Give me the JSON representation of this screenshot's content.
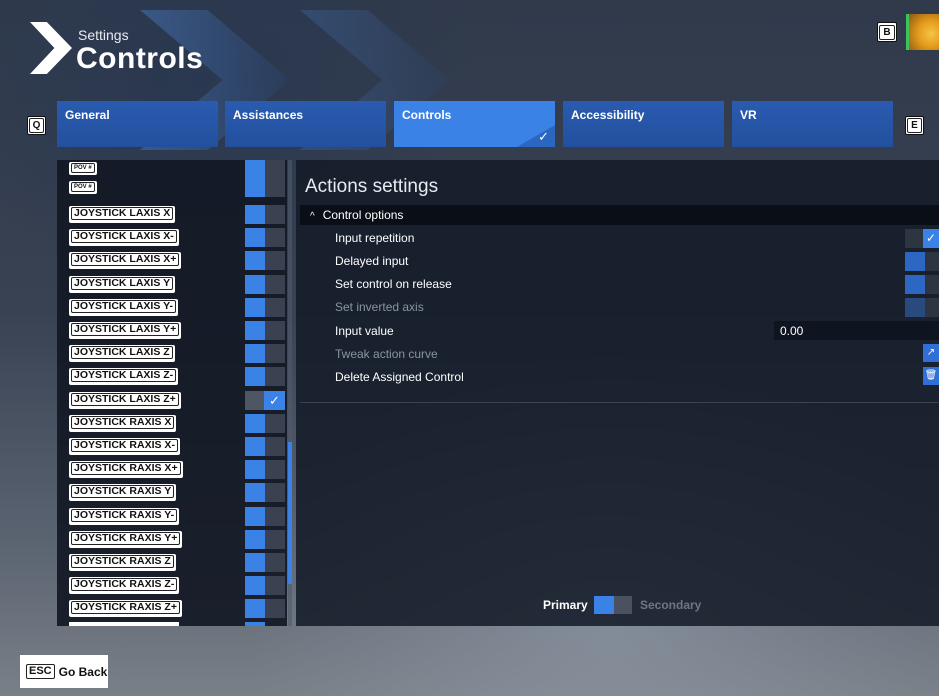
{
  "header": {
    "subtitle": "Settings",
    "title": "Controls",
    "key_b": "B"
  },
  "tabs": {
    "prev_key": "Q",
    "next_key": "E",
    "items": [
      {
        "label": "General"
      },
      {
        "label": "Assistances"
      },
      {
        "label": "Controls",
        "active": true
      },
      {
        "label": "Accessibility"
      },
      {
        "label": "VR"
      }
    ],
    "active_check": "✓"
  },
  "bindings": [
    {
      "label": "POV #",
      "small": true
    },
    {
      "label": "POV #",
      "small": true
    },
    {
      "label": "JOYSTICK LAXIS X"
    },
    {
      "label": "JOYSTICK LAXIS X-"
    },
    {
      "label": "JOYSTICK LAXIS X+"
    },
    {
      "label": "JOYSTICK LAXIS Y"
    },
    {
      "label": "JOYSTICK LAXIS Y-"
    },
    {
      "label": "JOYSTICK LAXIS Y+"
    },
    {
      "label": "JOYSTICK LAXIS Z"
    },
    {
      "label": "JOYSTICK LAXIS Z-"
    },
    {
      "label": "JOYSTICK LAXIS Z+",
      "selected": true
    },
    {
      "label": "JOYSTICK RAXIS X"
    },
    {
      "label": "JOYSTICK RAXIS X-"
    },
    {
      "label": "JOYSTICK RAXIS X+"
    },
    {
      "label": "JOYSTICK RAXIS Y"
    },
    {
      "label": "JOYSTICK RAXIS Y-"
    },
    {
      "label": "JOYSTICK RAXIS Y+"
    },
    {
      "label": "JOYSTICK RAXIS Z"
    },
    {
      "label": "JOYSTICK RAXIS Z-"
    },
    {
      "label": "JOYSTICK RAXIS Z+"
    }
  ],
  "actions": {
    "title": "Actions settings",
    "section": "Control options",
    "section_caret": "^",
    "options": [
      {
        "label": "Input repetition",
        "control": "toggle",
        "state": "on"
      },
      {
        "label": "Delayed input",
        "control": "toggle",
        "state": "off"
      },
      {
        "label": "Set control on release",
        "control": "toggle",
        "state": "off"
      },
      {
        "label": "Set inverted axis",
        "control": "toggle",
        "state": "disabled",
        "dim": true
      },
      {
        "label": "Input value",
        "control": "input",
        "value": "0.00"
      },
      {
        "label": "Tweak action curve",
        "control": "button",
        "icon": "curve-icon",
        "dim": true
      },
      {
        "label": "Delete Assigned Control",
        "control": "button",
        "icon": "trash-icon"
      }
    ]
  },
  "mode": {
    "primary": "Primary",
    "secondary": "Secondary"
  },
  "footer": {
    "esc_key": "ESC",
    "back_label": "Go Back"
  },
  "colors": {
    "accent": "#3b82e6",
    "tab": "#2a5bb0",
    "panel": "#141b28"
  }
}
